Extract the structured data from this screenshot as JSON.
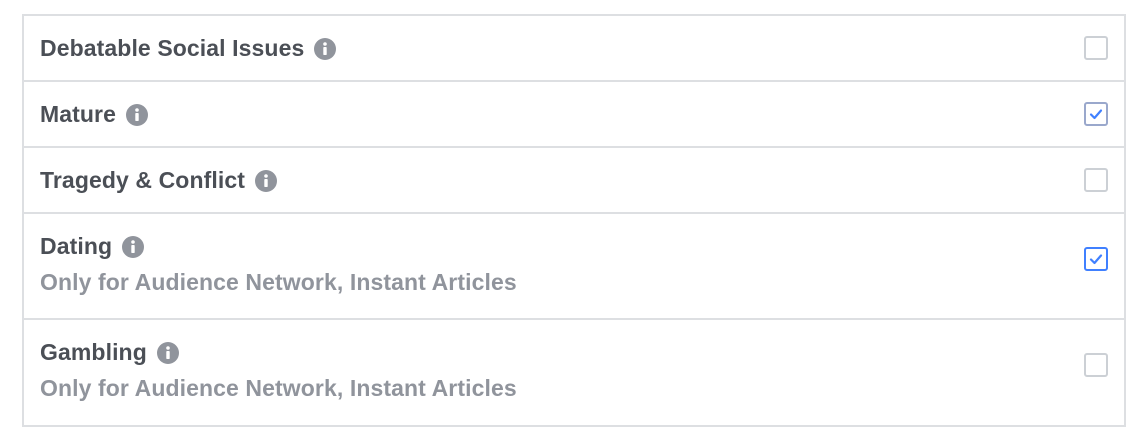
{
  "categories": [
    {
      "title": "Debatable Social Issues",
      "subtitle": "",
      "checked": false,
      "info_icon": "info-icon"
    },
    {
      "title": "Mature",
      "subtitle": "",
      "checked": true,
      "info_icon": "info-icon"
    },
    {
      "title": "Tragedy & Conflict",
      "subtitle": "",
      "checked": false,
      "info_icon": "info-icon"
    },
    {
      "title": "Dating",
      "subtitle": "Only for Audience Network, Instant Articles",
      "checked": true,
      "info_icon": "info-icon"
    },
    {
      "title": "Gambling",
      "subtitle": "Only for Audience Network, Instant Articles",
      "checked": false,
      "info_icon": "info-icon"
    }
  ],
  "colors": {
    "title_text": "#4b4f56",
    "subtitle_text": "#90949c",
    "border": "#dddfe2",
    "checkbox_border": "#ccd0d5",
    "check_mark": "#4080ff",
    "info_icon": "#90949c"
  }
}
